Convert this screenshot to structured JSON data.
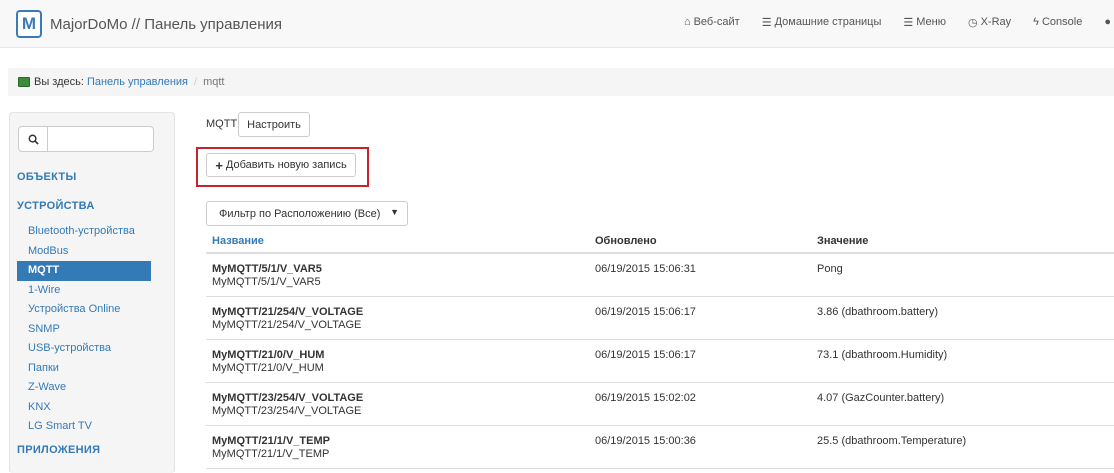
{
  "header": {
    "logo_letter": "M",
    "title": "MajorDoMo // Панель управления",
    "nav": [
      {
        "icon": "home-icon",
        "glyph": "⌂",
        "label": "Веб-сайт"
      },
      {
        "icon": "list-icon",
        "glyph": "☰",
        "label": "Домашние страницы"
      },
      {
        "icon": "menu-icon",
        "glyph": "☰",
        "label": "Меню"
      },
      {
        "icon": "clock-icon",
        "glyph": "◷",
        "label": "X-Ray"
      },
      {
        "icon": "bolt-icon",
        "glyph": "ϟ",
        "label": "Console"
      },
      {
        "icon": "globe-icon",
        "glyph": "●",
        "label": ""
      }
    ]
  },
  "breadcrumb": {
    "here_label": "Вы здесь:",
    "link": "Панель управления",
    "separator": "/",
    "current": "mqtt"
  },
  "sidebar": {
    "search_placeholder": "",
    "objects": "ОБЪЕКТЫ",
    "devices": "УСТРОЙСТВА",
    "apps": "ПРИЛОЖЕНИЯ",
    "items": [
      "Bluetooth-устройства",
      "ModBus",
      "MQTT",
      "1-Wire",
      "Устройства Online",
      "SNMP",
      "USB-устройства",
      "Папки",
      "Z-Wave",
      "KNX",
      "LG Smart TV"
    ],
    "active_item": "MQTT"
  },
  "main": {
    "module_label": "MQTT",
    "configure_button": "Настроить",
    "add_button": "Добавить новую запись",
    "filter_select": "Фильтр по Расположению (Все)",
    "columns": {
      "name": "Название",
      "updated": "Обновлено",
      "value": "Значение"
    },
    "rows": [
      {
        "title": "MyMQTT/5/1/V_VAR5",
        "path": "MyMQTT/5/1/V_VAR5",
        "updated": "06/19/2015 15:06:31",
        "value": "Pong"
      },
      {
        "title": "MyMQTT/21/254/V_VOLTAGE",
        "path": "MyMQTT/21/254/V_VOLTAGE",
        "updated": "06/19/2015 15:06:17",
        "value": "3.86 (dbathroom.battery)"
      },
      {
        "title": "MyMQTT/21/0/V_HUM",
        "path": "MyMQTT/21/0/V_HUM",
        "updated": "06/19/2015 15:06:17",
        "value": "73.1 (dbathroom.Humidity)"
      },
      {
        "title": "MyMQTT/23/254/V_VOLTAGE",
        "path": "MyMQTT/23/254/V_VOLTAGE",
        "updated": "06/19/2015 15:02:02",
        "value": "4.07 (GazCounter.battery)"
      },
      {
        "title": "MyMQTT/21/1/V_TEMP",
        "path": "MyMQTT/21/1/V_TEMP",
        "updated": "06/19/2015 15:00:36",
        "value": "25.5 (dbathroom.Temperature)"
      }
    ]
  }
}
